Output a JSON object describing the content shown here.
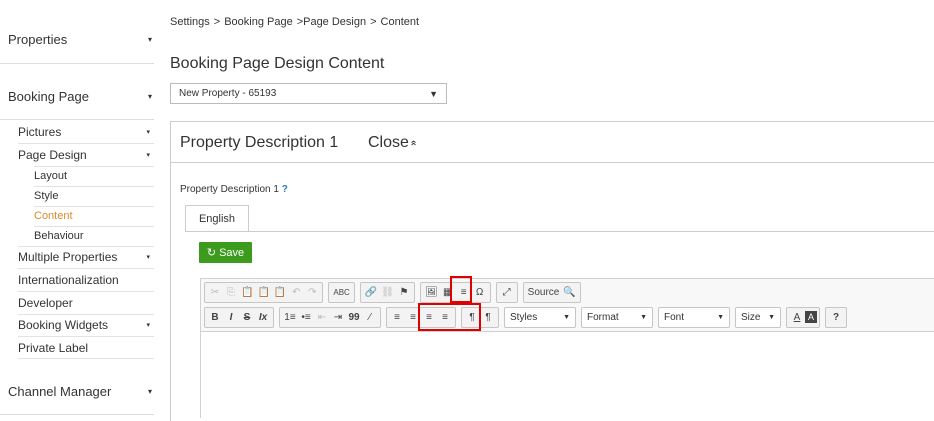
{
  "sidebar": {
    "sections": [
      {
        "label": "Properties"
      },
      {
        "label": "Booking Page"
      },
      {
        "label": "Channel Manager"
      }
    ],
    "items": [
      {
        "label": "Pictures"
      },
      {
        "label": "Page Design"
      },
      {
        "label": "Multiple Properties"
      },
      {
        "label": "Internationalization"
      },
      {
        "label": "Developer"
      },
      {
        "label": "Booking Widgets"
      },
      {
        "label": "Private Label"
      }
    ],
    "subitems": [
      {
        "label": "Layout"
      },
      {
        "label": "Style"
      },
      {
        "label": "Content",
        "active": true
      },
      {
        "label": "Behaviour"
      }
    ],
    "caret": "▾"
  },
  "breadcrumb": [
    "Settings",
    ">",
    "Booking Page",
    ">Page Design",
    ">",
    "Content"
  ],
  "page_title": "Booking Page Design Content",
  "property_select": {
    "value": "New Property - 65193",
    "arrow": "▼"
  },
  "panel": {
    "title": "Property Description 1",
    "close_label": "Close",
    "close_icon": "»",
    "field_label": "Property Description 1",
    "help": "?",
    "tab": "English",
    "save_label": "Save",
    "save_icon": "↻"
  },
  "toolbar": {
    "row1": {
      "clipboard": [
        "✂",
        "⎘",
        "📋",
        "📋",
        "📋",
        "↶",
        "↷"
      ],
      "spell": "ABC",
      "links": [
        "🔗",
        "⛓",
        "⚑"
      ],
      "insert": [
        "🖼",
        "▦",
        "≡",
        "Ω"
      ],
      "maximize": "⤢",
      "source_label": "Source",
      "preview": "🔍"
    },
    "row2": {
      "basic": [
        "B",
        "I",
        "S",
        "Ix"
      ],
      "lists": [
        "1≡",
        "•≡",
        "⇤",
        "⇥",
        "99",
        "⁄"
      ],
      "align": [
        "≡",
        "≡",
        "≡",
        "≡"
      ],
      "bidi": [
        "¶",
        "¶"
      ],
      "styles": "Styles",
      "format": "Format",
      "font": "Font",
      "size": "Size",
      "text_color": "A",
      "bg_color": "A",
      "help": "?"
    }
  },
  "colors": {
    "accent": "#d98a2b",
    "save": "#3c9b1d",
    "highlight": "#e00000",
    "help": "#2a7ab5"
  }
}
